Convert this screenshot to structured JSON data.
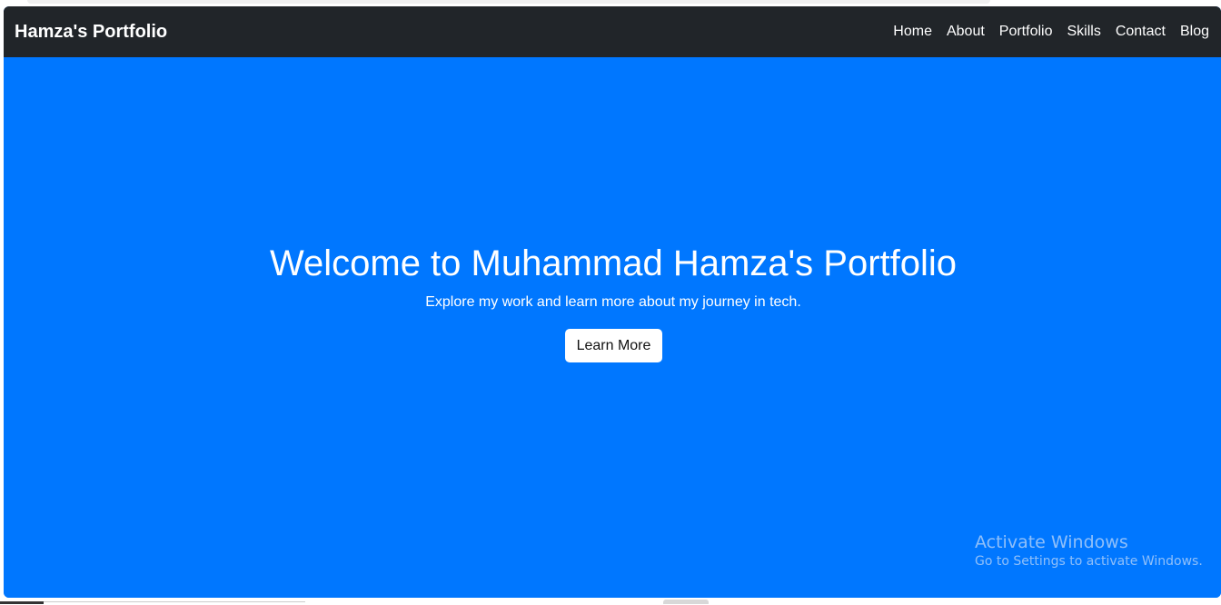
{
  "navbar": {
    "brand": "Hamza's Portfolio",
    "links": [
      {
        "label": "Home"
      },
      {
        "label": "About"
      },
      {
        "label": "Portfolio"
      },
      {
        "label": "Skills"
      },
      {
        "label": "Contact"
      },
      {
        "label": "Blog"
      }
    ],
    "background": "#212529"
  },
  "hero": {
    "title": "Welcome to Muhammad Hamza's Portfolio",
    "subtitle": "Explore my work and learn more about my journey in tech.",
    "button_label": "Learn More",
    "background": "#0077ff"
  },
  "watermark": {
    "title": "Activate Windows",
    "subtitle": "Go to Settings to activate Windows."
  }
}
